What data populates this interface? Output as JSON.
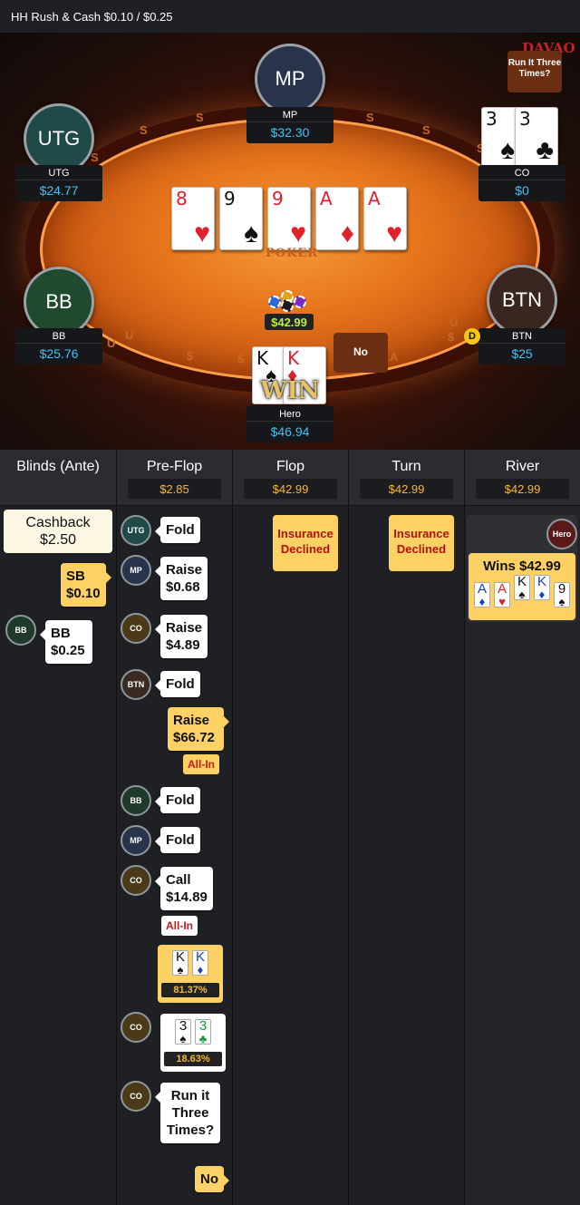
{
  "header": {
    "title": "HH  Rush & Cash $0.10 / $0.25"
  },
  "table": {
    "logo": "DAVAO",
    "table_mark": "POKER",
    "rail_letters": [
      "S",
      "S",
      "S",
      "S",
      "S",
      "S",
      "U",
      "U",
      "U",
      "$",
      "$",
      "$",
      "A",
      "A",
      "A"
    ],
    "pot": "$42.99",
    "dealer_button": "D",
    "win_text": "WIN",
    "seats": [
      {
        "pos": "MP",
        "name": "MP",
        "stack": "$32.30"
      },
      {
        "pos": "UTG",
        "name": "UTG",
        "stack": "$24.77"
      },
      {
        "pos": "CO",
        "name": "CO",
        "stack": "$0"
      },
      {
        "pos": "BB",
        "name": "BB",
        "stack": "$25.76"
      },
      {
        "pos": "BTN",
        "name": "BTN",
        "stack": "$25"
      },
      {
        "pos": "Hero",
        "name": "Hero",
        "stack": "$46.94"
      }
    ],
    "board": [
      {
        "rank": "8",
        "suit": "♥",
        "color": "red"
      },
      {
        "rank": "9",
        "suit": "♠",
        "color": "blk"
      },
      {
        "rank": "9",
        "suit": "♥",
        "color": "red"
      },
      {
        "rank": "A",
        "suit": "♦",
        "color": "red"
      },
      {
        "rank": "A",
        "suit": "♥",
        "color": "red"
      }
    ],
    "co_cards": [
      {
        "rank": "3",
        "suit": "♠"
      },
      {
        "rank": "3",
        "suit": "♣"
      }
    ],
    "hero_cards": [
      {
        "rank": "K",
        "suit": "♠",
        "color": "blk"
      },
      {
        "rank": "K",
        "suit": "♦",
        "color": "red"
      }
    ],
    "bubble_no": "No",
    "bubble_rit": "Run It Three Times?"
  },
  "history": {
    "columns": [
      {
        "title": "Blinds (Ante)",
        "pot": ""
      },
      {
        "title": "Pre-Flop",
        "pot": "$2.85"
      },
      {
        "title": "Flop",
        "pot": "$42.99"
      },
      {
        "title": "Turn",
        "pot": "$42.99"
      },
      {
        "title": "River",
        "pot": "$42.99"
      }
    ],
    "blinds": {
      "cashback_label": "Cashback",
      "cashback_value": "$2.50",
      "sb_label": "SB",
      "sb_value": "$0.10",
      "bb_pill": "BB",
      "bb_label": "BB",
      "bb_value": "$0.25"
    },
    "preflop": {
      "utg_pill": "UTG",
      "utg_action": "Fold",
      "mp_pill": "MP",
      "mp_action": "Raise",
      "mp_amount": "$0.68",
      "co_pill": "CO",
      "co_action": "Raise",
      "co_amount": "$4.89",
      "btn_pill": "BTN",
      "btn_action": "Fold",
      "hero_action": "Raise",
      "hero_amount": "$66.72",
      "hero_allin": "All-In",
      "bb_pill": "BB",
      "bb_action": "Fold",
      "mp2_pill": "MP",
      "mp2_action": "Fold",
      "co2_pill": "CO",
      "co2_action": "Call",
      "co2_amount": "$14.89",
      "co2_allin": "All-In",
      "hero_hand_equity": "81.37%",
      "co3_pill": "CO",
      "co_hand_equity": "18.63%",
      "co4_pill": "CO",
      "rit_text_1": "Run it",
      "rit_text_2": "Three",
      "rit_text_3": "Times?",
      "hero_reply": "No"
    },
    "flop": {
      "insurance_1": "Insurance",
      "insurance_2": "Declined"
    },
    "turn": {
      "insurance_1": "Insurance",
      "insurance_2": "Declined"
    },
    "river": {
      "hero_pill": "Hero",
      "wins": "Wins $42.99",
      "hand": [
        {
          "rank": "A",
          "suit": "♦",
          "color": "blue"
        },
        {
          "rank": "A",
          "suit": "♥",
          "color": "red"
        },
        {
          "rank": "K",
          "suit": "♠",
          "color": "blk"
        },
        {
          "rank": "K",
          "suit": "♦",
          "color": "blue"
        },
        {
          "rank": "9",
          "suit": "♠",
          "color": "blk"
        }
      ]
    }
  }
}
